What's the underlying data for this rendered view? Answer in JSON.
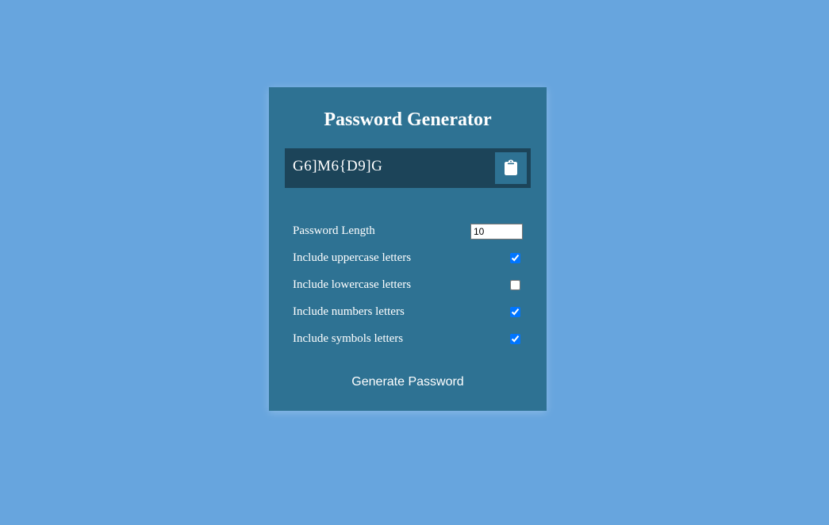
{
  "app": {
    "title": "Password Generator"
  },
  "result": {
    "password": "G6]M6{D9]G",
    "copy_icon": "clipboard-icon"
  },
  "settings": {
    "length": {
      "label": "Password Length",
      "value": "10"
    },
    "uppercase": {
      "label": "Include uppercase letters",
      "checked": true
    },
    "lowercase": {
      "label": "Include lowercase letters",
      "checked": false
    },
    "numbers": {
      "label": "Include numbers letters",
      "checked": true
    },
    "symbols": {
      "label": "Include symbols letters",
      "checked": true
    }
  },
  "generate_button": {
    "label": "Generate Password"
  },
  "colors": {
    "background": "#67a5de",
    "card": "#2e7293",
    "result_bg": "#1c4459",
    "checkbox_accent": "#0075ff"
  }
}
